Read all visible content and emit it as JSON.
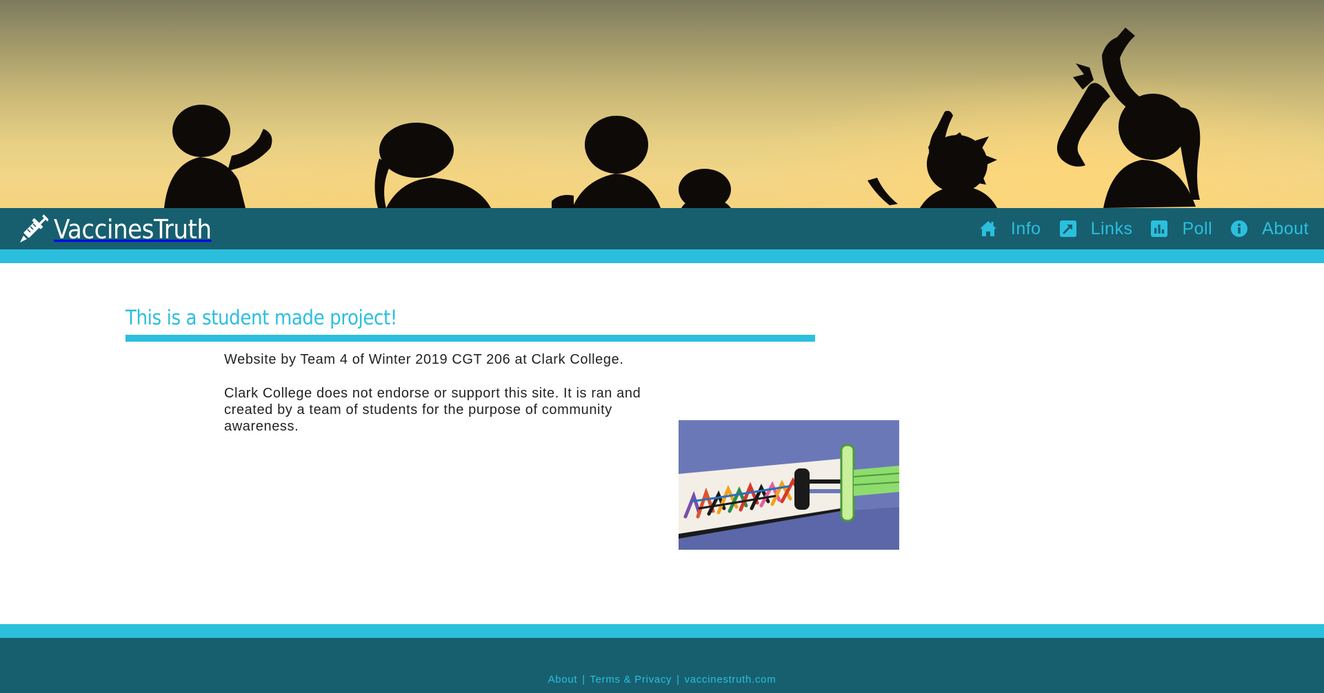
{
  "site": {
    "brand": "VaccinesTruth",
    "brand_icon": "syringe-icon"
  },
  "nav": {
    "items": [
      {
        "label": "Info",
        "icon": "home-icon"
      },
      {
        "label": "Links",
        "icon": "external-link-icon"
      },
      {
        "label": "Poll",
        "icon": "bar-chart-icon"
      },
      {
        "label": "About",
        "icon": "info-icon"
      }
    ]
  },
  "content": {
    "heading": "This is a student made project!",
    "paragraph1": "Website by Team 4 of Winter 2019 CGT 206 at Clark College.",
    "paragraph2": "Clark College does not endorse or support this site. It is ran and created by a team of students for the purpose of community awareness."
  },
  "footer": {
    "about": "About",
    "terms": "Terms & Privacy",
    "domain": "vaccinestruth.com",
    "separator": "|"
  },
  "colors": {
    "nav_bg": "#175f6f",
    "accent": "#2bbfdd",
    "brand_text": "#ffffff",
    "body_text": "#222222"
  }
}
